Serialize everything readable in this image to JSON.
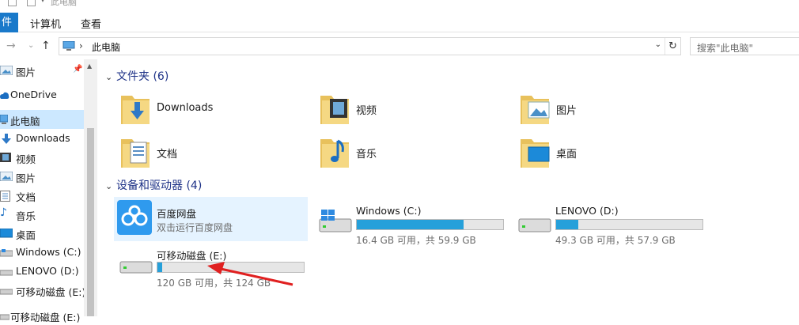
{
  "window": {
    "title": "此电脑"
  },
  "ribbon": {
    "tabs": [
      {
        "label": "文件"
      },
      {
        "label": "计算机"
      },
      {
        "label": "查看"
      }
    ],
    "file_visible": "件"
  },
  "address": {
    "path": "此电脑",
    "search_placeholder": "搜索\"此电脑\""
  },
  "sidebar": {
    "items": [
      {
        "label": "图片",
        "icon": "pictures-icon"
      },
      {
        "label": "OneDrive",
        "icon": "cloud-icon"
      },
      {
        "label": "此电脑",
        "icon": "pc-icon"
      },
      {
        "label": "Downloads",
        "icon": "download-icon"
      },
      {
        "label": "视频",
        "icon": "video-icon"
      },
      {
        "label": "图片",
        "icon": "pictures-icon"
      },
      {
        "label": "文档",
        "icon": "document-icon"
      },
      {
        "label": "音乐",
        "icon": "music-icon"
      },
      {
        "label": "桌面",
        "icon": "desktop-icon"
      },
      {
        "label": "Windows (C:)",
        "icon": "drive-icon"
      },
      {
        "label": "LENOVO (D:)",
        "icon": "drive-icon"
      },
      {
        "label": "可移动磁盘 (E:)",
        "icon": "usb-drive-icon"
      },
      {
        "label": "可移动磁盘 (E:)",
        "icon": "usb-drive-icon"
      }
    ]
  },
  "folders": {
    "heading": "文件夹 (6)",
    "items": [
      {
        "label": "Downloads",
        "icon": "downloads-folder-icon"
      },
      {
        "label": "视频",
        "icon": "videos-folder-icon"
      },
      {
        "label": "图片",
        "icon": "pictures-folder-icon"
      },
      {
        "label": "文档",
        "icon": "documents-folder-icon"
      },
      {
        "label": "音乐",
        "icon": "music-folder-icon"
      },
      {
        "label": "桌面",
        "icon": "desktop-folder-icon"
      }
    ]
  },
  "devices": {
    "heading": "设备和驱动器 (4)",
    "items": [
      {
        "name": "百度网盘",
        "sub": "双击运行百度网盘",
        "icon": "baidu-netdisk-icon"
      },
      {
        "name": "Windows (C:)",
        "free": "16.4 GB 可用，共 59.9 GB",
        "used_fraction": 0.73,
        "icon": "windows-drive-icon"
      },
      {
        "name": "LENOVO (D:)",
        "free": "49.3 GB 可用，共 57.9 GB",
        "used_fraction": 0.15,
        "icon": "hard-drive-icon"
      },
      {
        "name": "可移动磁盘 (E:)",
        "free": "120 GB 可用，共 124 GB",
        "used_fraction": 0.03,
        "icon": "removable-drive-icon"
      }
    ]
  },
  "colors": {
    "accent": "#1979ca",
    "bar_fill": "#26a0da",
    "selection": "#cce8ff",
    "heading": "#1e3287",
    "annotation": "#e02020"
  }
}
